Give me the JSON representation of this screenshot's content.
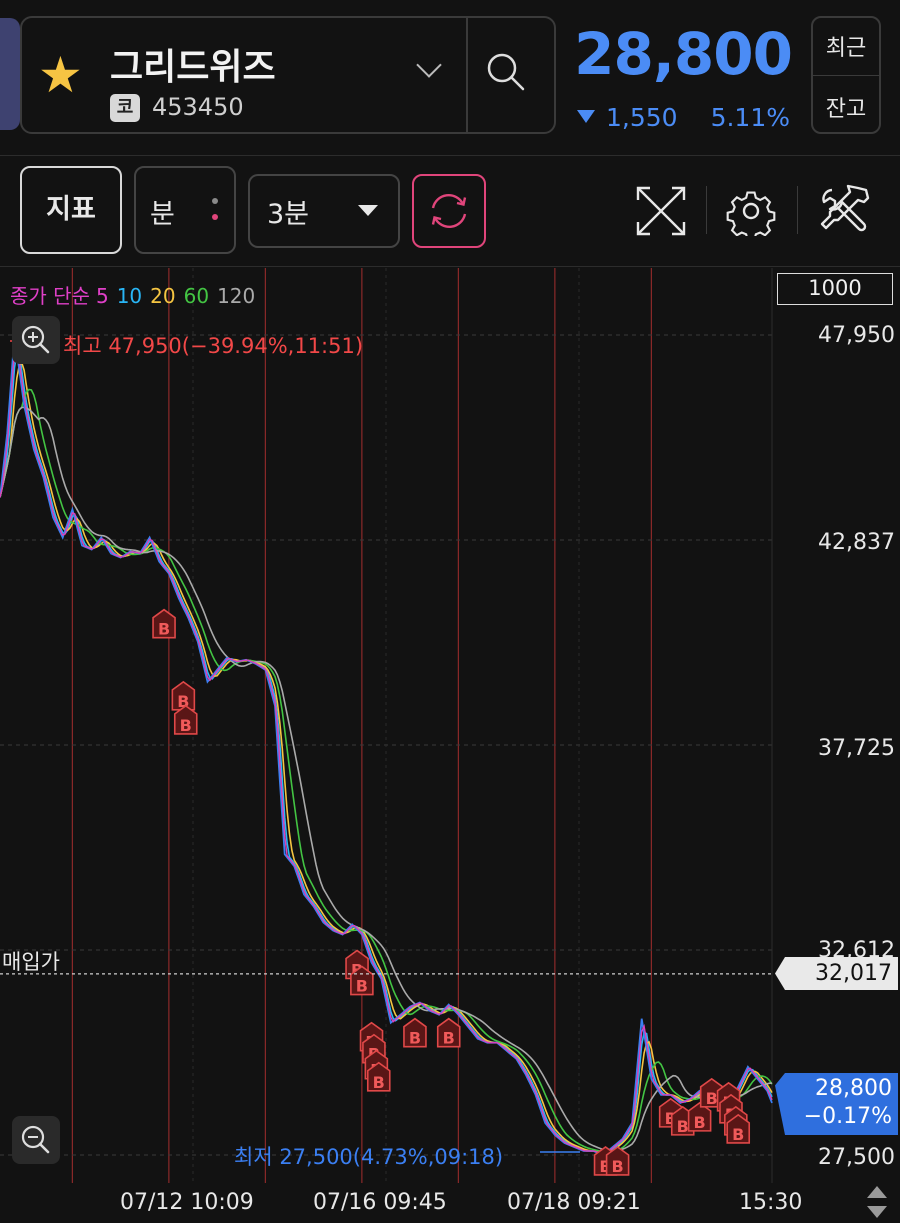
{
  "header": {
    "stock_name": "그리드위즈",
    "market_badge": "코",
    "stock_code": "453450",
    "price": "28,800",
    "change": "1,550",
    "change_rate": "5.11%",
    "btn_recent": "최근",
    "btn_balance": "잔고"
  },
  "toolbar": {
    "indicator_label": "지표",
    "unit_label": "분",
    "interval_label": "3분"
  },
  "legend": {
    "prefix": "종가 단순",
    "periods": [
      {
        "label": "5",
        "color": "#e040c8"
      },
      {
        "label": "10",
        "color": "#29b6f6"
      },
      {
        "label": "20",
        "color": "#f5c542"
      },
      {
        "label": "60",
        "color": "#43c443"
      },
      {
        "label": "120",
        "color": "#aaaaaa"
      }
    ]
  },
  "chart": {
    "scale_box": "1000",
    "high_label": "최고 47,950(−39.94%,11:51)",
    "low_label": "최저 27,500(4.73%,09:18)",
    "buy_price_label": "매입가",
    "avg_price_tag": "32,017",
    "current_price_tag": "28,800",
    "current_rate_tag": "−0.17%",
    "marker_letter": "B"
  },
  "chart_data": {
    "type": "line",
    "y_ticks": [
      "47,950",
      "42,837",
      "37,725",
      "32,612",
      "27,500"
    ],
    "ylim": [
      27500,
      47950
    ],
    "x_ticks": [
      "07/12 10:09",
      "07/16 09:45",
      "07/18 09:21",
      "15:30"
    ],
    "high": 47950,
    "low": 27500,
    "buy_price": 32017,
    "current": 28800,
    "price_series": [
      [
        0,
        43900
      ],
      [
        3,
        45500
      ],
      [
        6,
        47950
      ],
      [
        10,
        46200
      ],
      [
        14,
        45100
      ],
      [
        18,
        44400
      ],
      [
        22,
        43400
      ],
      [
        26,
        42900
      ],
      [
        30,
        43600
      ],
      [
        34,
        42700
      ],
      [
        38,
        42600
      ],
      [
        42,
        42900
      ],
      [
        46,
        42500
      ],
      [
        50,
        42400
      ],
      [
        54,
        42550
      ],
      [
        58,
        42500
      ],
      [
        62,
        42900
      ],
      [
        66,
        42300
      ],
      [
        70,
        42000
      ],
      [
        74,
        41400
      ],
      [
        78,
        40900
      ],
      [
        82,
        40300
      ],
      [
        86,
        39300
      ],
      [
        90,
        39600
      ],
      [
        94,
        39900
      ],
      [
        98,
        39800
      ],
      [
        102,
        39850
      ],
      [
        106,
        39750
      ],
      [
        110,
        39600
      ],
      [
        114,
        38700
      ],
      [
        118,
        35000
      ],
      [
        122,
        34700
      ],
      [
        126,
        34000
      ],
      [
        130,
        33700
      ],
      [
        134,
        33300
      ],
      [
        138,
        33100
      ],
      [
        142,
        33000
      ],
      [
        146,
        33250
      ],
      [
        150,
        33000
      ],
      [
        154,
        32300
      ],
      [
        158,
        31900
      ],
      [
        162,
        30800
      ],
      [
        166,
        31000
      ],
      [
        170,
        31200
      ],
      [
        174,
        31300
      ],
      [
        178,
        31100
      ],
      [
        182,
        31000
      ],
      [
        186,
        31250
      ],
      [
        190,
        31000
      ],
      [
        194,
        30700
      ],
      [
        198,
        30400
      ],
      [
        202,
        30300
      ],
      [
        206,
        30300
      ],
      [
        210,
        30100
      ],
      [
        214,
        29900
      ],
      [
        218,
        29500
      ],
      [
        222,
        29000
      ],
      [
        226,
        28300
      ],
      [
        230,
        28000
      ],
      [
        234,
        27800
      ],
      [
        238,
        27700
      ],
      [
        242,
        27600
      ],
      [
        246,
        27600
      ],
      [
        250,
        27500
      ],
      [
        254,
        27700
      ],
      [
        258,
        27900
      ],
      [
        262,
        28300
      ],
      [
        266,
        30900
      ],
      [
        270,
        29400
      ],
      [
        274,
        29000
      ],
      [
        278,
        29000
      ],
      [
        282,
        28800
      ],
      [
        286,
        28900
      ],
      [
        290,
        29100
      ],
      [
        294,
        29000
      ],
      [
        298,
        29000
      ],
      [
        302,
        28700
      ],
      [
        306,
        29200
      ],
      [
        310,
        29700
      ],
      [
        314,
        29400
      ],
      [
        318,
        29100
      ],
      [
        320,
        28800
      ]
    ],
    "ma_periods": [
      5,
      10,
      20,
      60,
      120
    ],
    "vertical_date_lines_at": [
      30,
      70,
      110,
      150,
      190,
      230,
      270
    ],
    "buy_markers": [
      [
        68,
        41100
      ],
      [
        76,
        39300
      ],
      [
        77,
        38700
      ],
      [
        148,
        32600
      ],
      [
        150,
        32200
      ],
      [
        154,
        30800
      ],
      [
        155,
        30500
      ],
      [
        156,
        30100
      ],
      [
        157,
        29800
      ],
      [
        172,
        30900
      ],
      [
        186,
        30900
      ],
      [
        251,
        27700
      ],
      [
        256,
        27700
      ],
      [
        278,
        28900
      ],
      [
        283,
        28700
      ],
      [
        290,
        28800
      ],
      [
        295,
        29400
      ],
      [
        302,
        29300
      ],
      [
        303,
        29000
      ],
      [
        305,
        28700
      ],
      [
        306,
        28500
      ]
    ]
  }
}
